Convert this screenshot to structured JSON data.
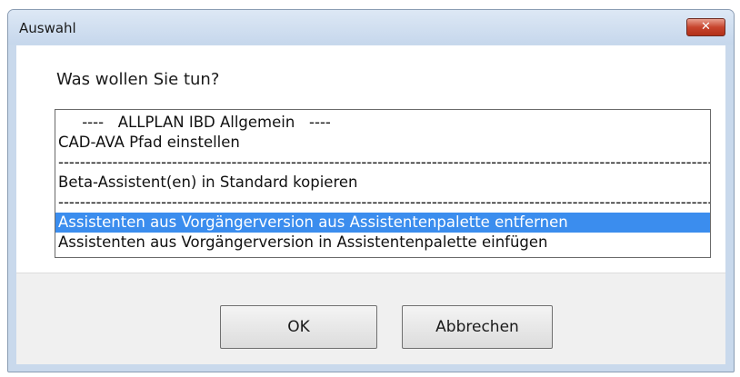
{
  "window": {
    "title": "Auswahl",
    "close_glyph": "✕",
    "close_icon": "close-icon"
  },
  "prompt": "Was wollen Sie tun?",
  "list": {
    "items": [
      "     ----   ALLPLAN IBD Allgemein   ----",
      "CAD-AVA Pfad einstellen",
      "-------------------------------------------------------------------------------------------------------------------------------------",
      "Beta-Assistent(en) in Standard kopieren",
      "-------------------------------------------------------------------------------------------------------------------------------------",
      "Assistenten aus Vorgängerversion aus Assistentenpalette entfernen",
      "Assistenten aus Vorgängerversion in Assistentenpalette einfügen"
    ],
    "selected_index": 5
  },
  "buttons": {
    "ok": "OK",
    "cancel": "Abbrechen"
  },
  "colors": {
    "selection": "#3b8dee",
    "window_frame": "#c9d9ec",
    "close_button": "#c7442d"
  }
}
